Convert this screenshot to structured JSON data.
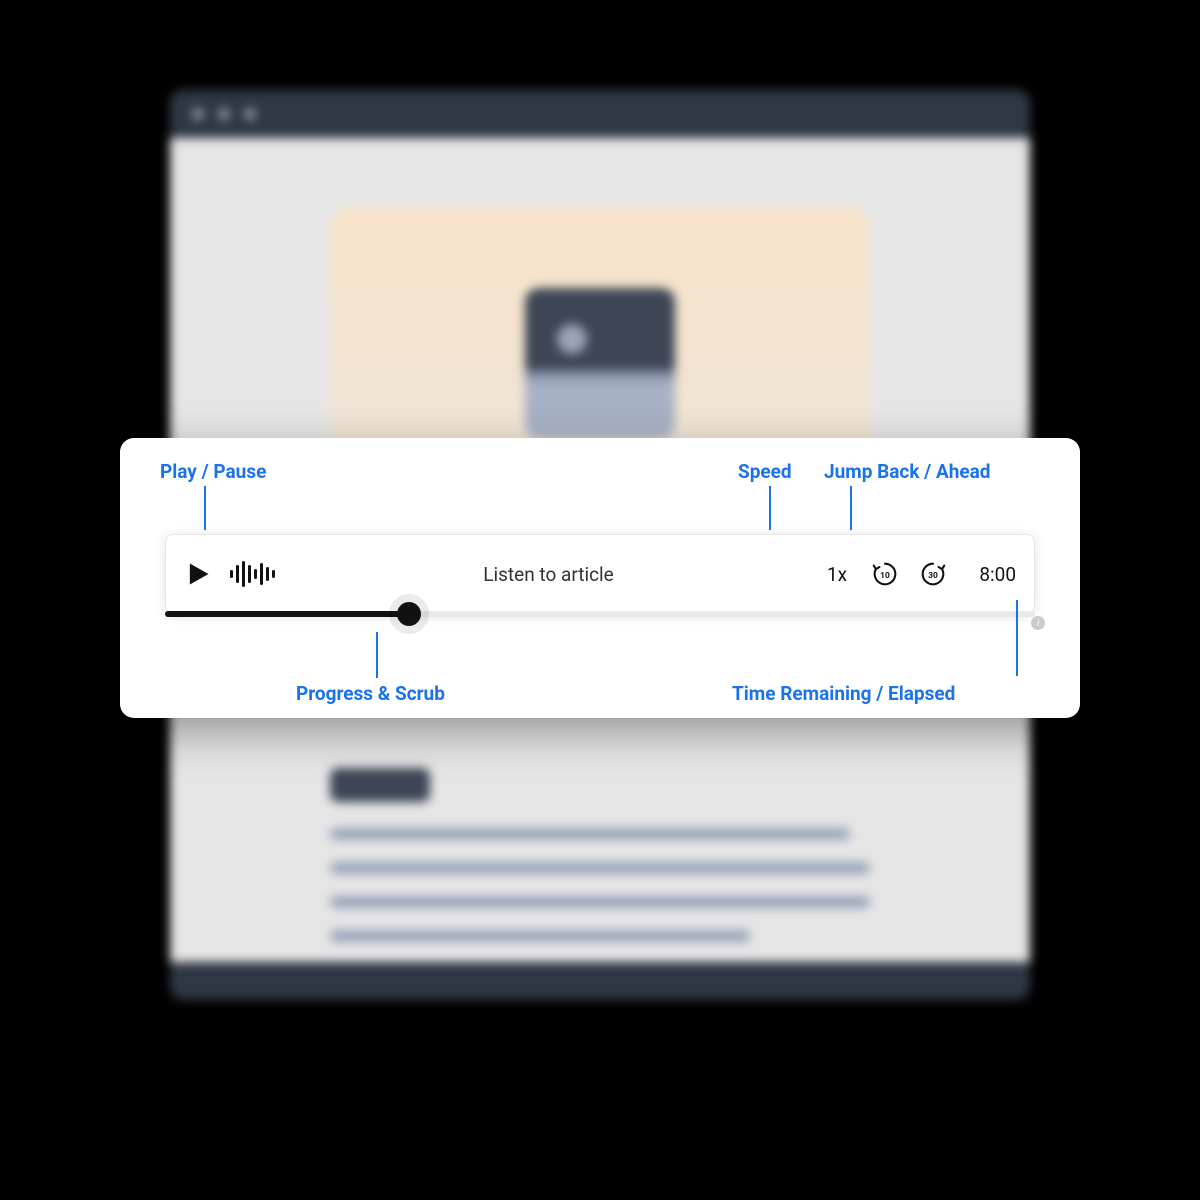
{
  "annotations": {
    "play_pause": "Play / Pause",
    "speed": "Speed",
    "jump": "Jump Back / Ahead",
    "progress": "Progress & Scrub",
    "time": "Time Remaining / Elapsed"
  },
  "player": {
    "title": "Listen to article",
    "speed_label": "1x",
    "skip_back_seconds": "10",
    "skip_ahead_seconds": "30",
    "time_display": "8:00"
  }
}
